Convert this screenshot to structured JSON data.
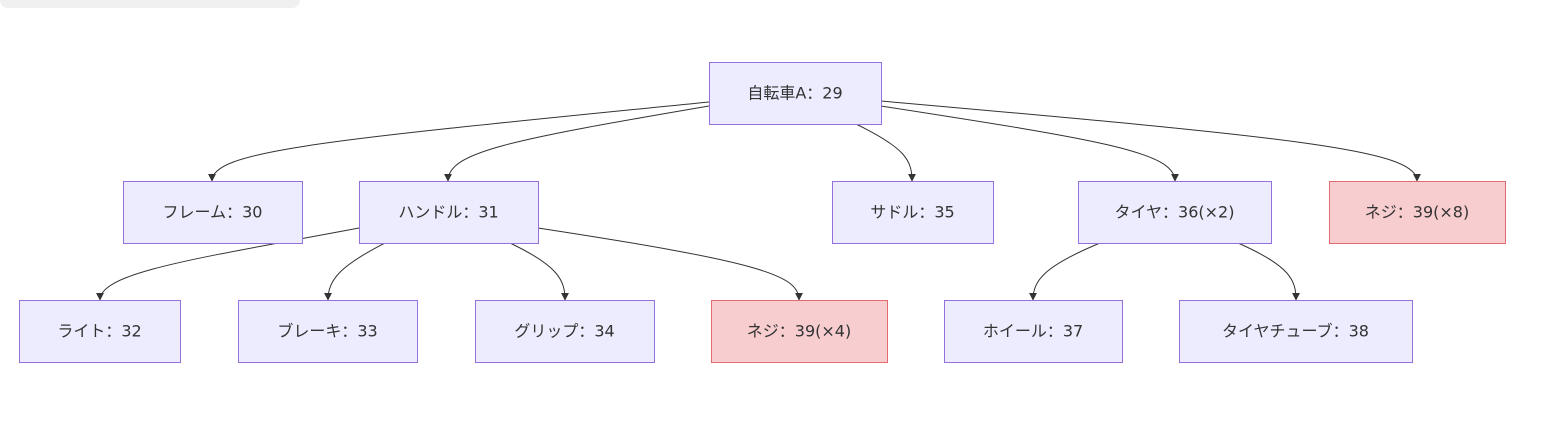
{
  "colors": {
    "node_fill": "#ececfe",
    "node_stroke": "#9370db",
    "highlight_fill": "#f7cdd0",
    "highlight_stroke": "#e46a6f",
    "edge": "#333333",
    "text": "#333333"
  },
  "nodes": {
    "root": {
      "label": "自転車A：29",
      "highlight": false
    },
    "frame": {
      "label": "フレーム：30",
      "highlight": false
    },
    "handle": {
      "label": "ハンドル：31",
      "highlight": false
    },
    "saddle": {
      "label": "サドル：35",
      "highlight": false
    },
    "tire": {
      "label": "タイヤ：36(×2)",
      "highlight": false
    },
    "screw8": {
      "label": "ネジ：39(×8)",
      "highlight": true
    },
    "light": {
      "label": "ライト：32",
      "highlight": false
    },
    "brake": {
      "label": "ブレーキ：33",
      "highlight": false
    },
    "grip": {
      "label": "グリップ：34",
      "highlight": false
    },
    "screw4": {
      "label": "ネジ：39(×4)",
      "highlight": true
    },
    "wheel": {
      "label": "ホイール：37",
      "highlight": false
    },
    "tube": {
      "label": "タイヤチューブ：38",
      "highlight": false
    }
  },
  "edges": [
    {
      "from": "root",
      "to": "frame"
    },
    {
      "from": "root",
      "to": "handle"
    },
    {
      "from": "root",
      "to": "saddle"
    },
    {
      "from": "root",
      "to": "tire"
    },
    {
      "from": "root",
      "to": "screw8"
    },
    {
      "from": "handle",
      "to": "light"
    },
    {
      "from": "handle",
      "to": "brake"
    },
    {
      "from": "handle",
      "to": "grip"
    },
    {
      "from": "handle",
      "to": "screw4"
    },
    {
      "from": "tire",
      "to": "wheel"
    },
    {
      "from": "tire",
      "to": "tube"
    }
  ]
}
